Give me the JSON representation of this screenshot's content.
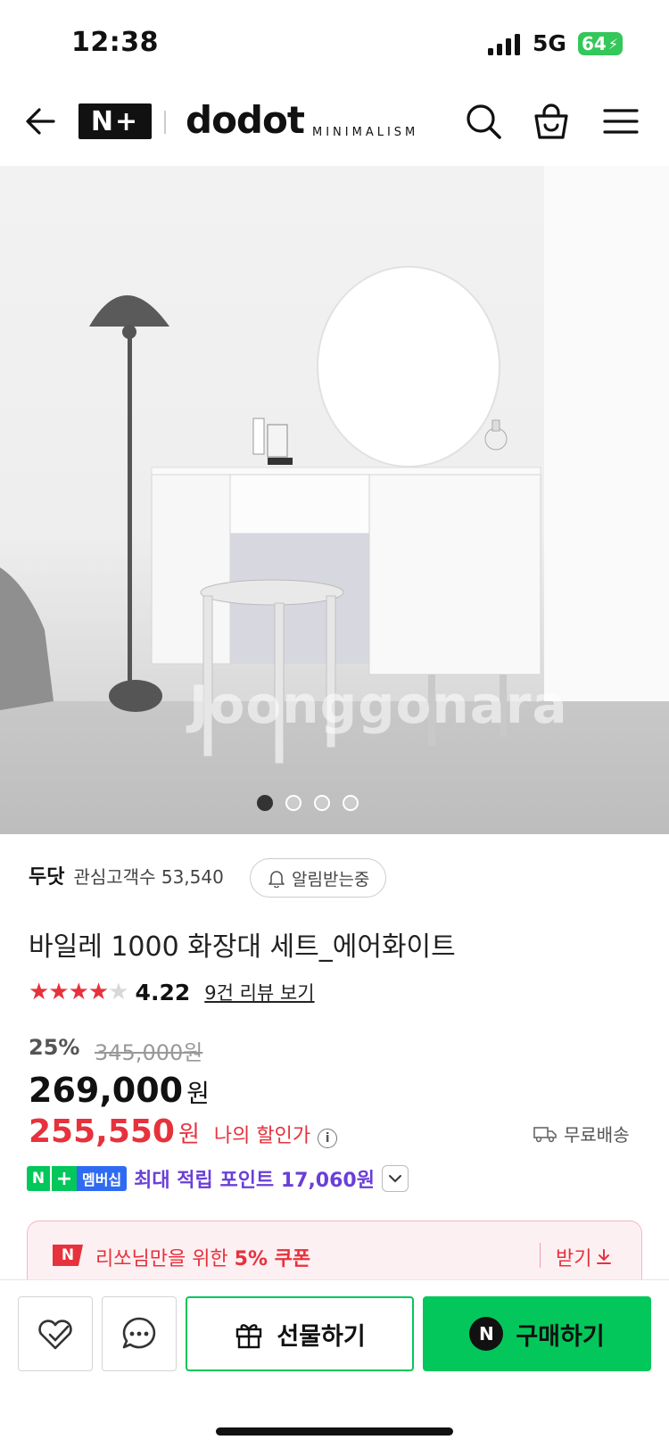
{
  "status_bar": {
    "time": "12:38",
    "network": "5G",
    "battery": "64"
  },
  "header": {
    "badge": "N+",
    "brand": "dodot",
    "brand_sub": "MINIMALISM",
    "icons": [
      "back-arrow-icon",
      "search-icon",
      "shopping-bag-icon",
      "menu-icon"
    ]
  },
  "hero": {
    "watermark": "Joonggonara",
    "slides_total": 4,
    "slide_active": 1
  },
  "store": {
    "name": "두닷",
    "fans_label": "관심고객수 53,540",
    "notify_label": "알림받는중"
  },
  "product": {
    "title": "바일레 1000 화장대 세트_에어화이트",
    "rating": {
      "score": "4.22",
      "stars": 4.22,
      "review_link": "9건 리뷰 보기"
    },
    "discount_pct": "25%",
    "original_price": "345,000원",
    "price": "269,000",
    "price_unit": "원",
    "my_price": "255,550",
    "my_price_unit": "원",
    "my_price_label": "나의 할인가",
    "shipping": "무료배송",
    "membership_badge": {
      "n": "N",
      "plus": "+",
      "label": "멤버십"
    },
    "points_label": "최대 적립 포인트 17,060원"
  },
  "coupon": {
    "logo": "N",
    "text_prefix": "리쏘님만을 위한 ",
    "text_strong": "5% 쿠폰",
    "action": "받기"
  },
  "bottom_bar": {
    "gift_label": "선물하기",
    "buy_label": "구매하기",
    "buy_logo": "N"
  },
  "colors": {
    "naver_green": "#03c75a",
    "sale_red": "#e6323c",
    "points_purple": "#6a3fd8"
  }
}
